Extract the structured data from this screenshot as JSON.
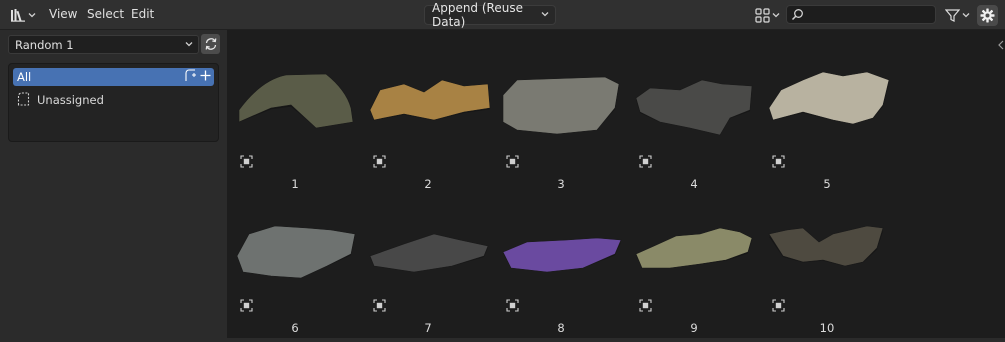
{
  "header": {
    "editor_type_icon": "asset-browser-icon",
    "menus": [
      "View",
      "Select",
      "Edit"
    ],
    "import_method": "Append (Reuse Data)",
    "search_value": "",
    "view_mode_icon": "thumbnail-grid-icon",
    "filter_icon": "funnel-icon",
    "settings_icon": "gear-icon"
  },
  "sidebar": {
    "library": "Random 1",
    "catalogs": [
      {
        "label": "All",
        "selected": true
      },
      {
        "label": "Unassigned",
        "selected": false
      }
    ]
  },
  "assets": [
    {
      "name": "1",
      "color": "#5a5c48"
    },
    {
      "name": "2",
      "color": "#a88244"
    },
    {
      "name": "3",
      "color": "#7a7a72"
    },
    {
      "name": "4",
      "color": "#4a4a48"
    },
    {
      "name": "5",
      "color": "#b8b2a0"
    },
    {
      "name": "6",
      "color": "#6e7270"
    },
    {
      "name": "7",
      "color": "#484848"
    },
    {
      "name": "8",
      "color": "#6a4aa0"
    },
    {
      "name": "9",
      "color": "#8a8a68"
    },
    {
      "name": "10",
      "color": "#4e4a40"
    }
  ],
  "colors": {
    "accent": "#4772b3",
    "header_bg": "#303030",
    "sidebar_bg": "#2b2b2b",
    "main_bg": "#1d1d1d"
  }
}
